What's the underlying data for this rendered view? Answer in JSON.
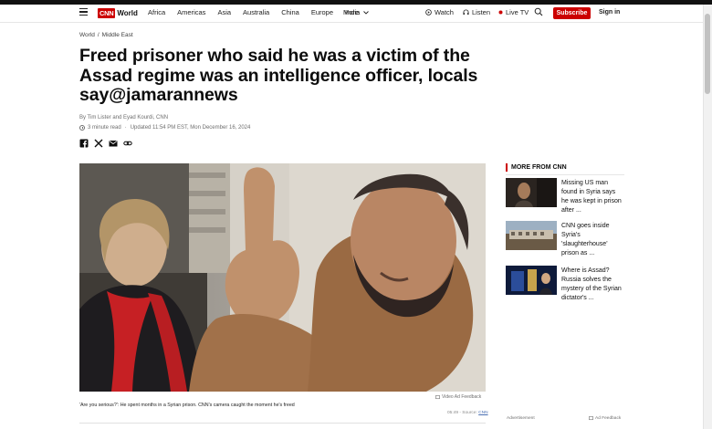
{
  "nav": {
    "logo_brand": "CNN",
    "logo_section": "World",
    "links": [
      "Africa",
      "Americas",
      "Asia",
      "Australia",
      "China",
      "Europe",
      "India"
    ],
    "more_label": "More",
    "watch_label": "Watch",
    "listen_label": "Listen",
    "live_label": "Live TV",
    "subscribe_label": "Subscribe",
    "signin_label": "Sign in"
  },
  "article": {
    "breadcrumb": [
      "World",
      "Middle East"
    ],
    "breadcrumb_sep": "/",
    "headline": "Freed prisoner who said he was a victim of the Assad regime was an intelligence officer, locals say@jamarannews",
    "byline": "By Tim Lister and Eyad Kourdi, CNN",
    "read_time": "3 minute read",
    "updated": "Updated 11:54 PM EST, Mon December 16, 2024",
    "video_feedback": "Video Ad Feedback",
    "caption": "'Are you serious?': He spent months in a Syrian prison. CNN's camera caught the moment he's freed",
    "duration": "05:49",
    "source_prefix": "- Source:",
    "source_name": "CNN"
  },
  "sidebar": {
    "heading": "MORE FROM CNN",
    "stories": [
      {
        "title": "Missing US man found in Syria says he was kept in prison after ..."
      },
      {
        "title": "CNN goes inside Syria's 'slaughterhouse' prison as ..."
      },
      {
        "title": "Where is Assad? Russia solves the mystery of the Syrian dictator's ..."
      }
    ],
    "ad_label": "Advertisement",
    "ad_feedback": "Ad Feedback"
  },
  "colors": {
    "brand_red": "#cc0000",
    "text": "#0c0c0c",
    "muted": "#6e6e6e"
  },
  "icons": [
    "menu-icon",
    "play-circle-icon",
    "headphones-icon",
    "live-dot-icon",
    "search-icon",
    "clock-icon",
    "facebook-icon",
    "x-icon",
    "email-icon",
    "link-icon",
    "feedback-icon"
  ]
}
